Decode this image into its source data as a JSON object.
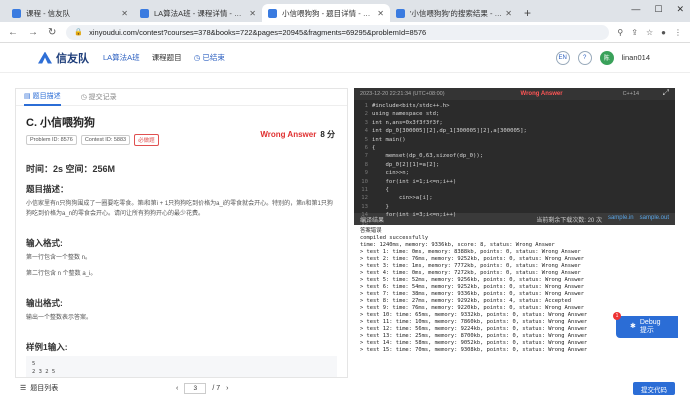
{
  "tabs": [
    {
      "title": "课程 - 信友队",
      "color": "#3a7be0",
      "active": false
    },
    {
      "title": "LA算法A班 - 课程详情 - 信友队",
      "color": "#3a7be0",
      "active": false
    },
    {
      "title": "小信喂狗狗 - 题目详情 - 信友队",
      "color": "#3a7be0",
      "active": true
    },
    {
      "title": "'小信喂狗狗'的搜索结果 - 信友队",
      "color": "#3a7be0",
      "active": false
    }
  ],
  "url": "xinyoudui.com/contest?courses=378&books=722&pages=20945&fragments=69295&problemId=8576",
  "header": {
    "brand": "信友队",
    "course": "LA算法A班",
    "nav1": "课程题目",
    "nav2": "已结束",
    "lang": "EN",
    "user": "linan014",
    "avatar": "陈"
  },
  "left": {
    "tab1": "题目描述",
    "tab2": "提交记录",
    "title": "C. 小信喂狗狗",
    "pid": "Problem ID: 8576",
    "cid": "Contest ID: 5883",
    "tag": "必做题",
    "verdict": "Wrong Answer",
    "score": "8 分",
    "limits": "时间：2s 空间：256M",
    "desc_h": "题目描述：",
    "desc": "小信家里有n只狗狗围成了一圈要吃零食。第i和第i + 1只狗狗吃到价格为a_i的零食就会开心。特别的，第n和第1只狗狗吃到价格为a_n的零食会开心。请问让所有狗狗开心的最少花费。",
    "input_h": "输入格式:",
    "input1": "第一行包含一个整数 n。",
    "input2": "第二行包含 n 个整数 a_i。",
    "output_h": "输出格式:",
    "output1": "输出一个整数表示答案。",
    "sample_h": "样例1输入:",
    "sample": "5\n2 3 2 5"
  },
  "bottom": {
    "qlist": "题目列表",
    "page": "3",
    "total": "/ 7",
    "submit": "提交代码"
  },
  "editor": {
    "time": "2023-12-20 22:21:34 (UTC+08:00)",
    "verdict": "Wrong Answer",
    "lang": "C++14",
    "lines": [
      "1",
      "2",
      "3",
      "4",
      "5",
      "6",
      "7",
      "8",
      "9",
      "10",
      "11",
      "12",
      "13",
      "14",
      "15"
    ],
    "code": "#include<bits/stdc++.h>\nusing namespace std;\nint n,ans=0x3f3f3f3f;\nint dp_0[300005][2],dp_1[300005][2],a[300005];\nint main()\n{\n    memset(dp_0,63,sizeof(dp_0));\n    dp_0[2][1]=a[2];\n    cin>>n;\n    for(int i=1;i<=n;i++)\n    {\n        cin>>a[i];\n    }\n    for(int i=3;i<=n;i++)"
  },
  "judge": {
    "title": "编译结果",
    "remaining": "当前剩余下载次数: 20 次",
    "in": "sample.in",
    "out": "sample.out",
    "text": "答案错误\ncompiled successfully\ntime: 1240ms, memory: 9336kb, score: 8, status: Wrong Answer\n> test 1: time: 0ms, memory: 8388kb, points: 0, status: Wrong Answer\n> test 2: time: 76ms, memory: 9252kb, points: 0, status: Wrong Answer\n> test 3: time: 1ms, memory: 7772kb, points: 0, status: Wrong Answer\n> test 4: time: 0ms, memory: 7272kb, points: 0, status: Wrong Answer\n> test 5: time: 52ms, memory: 9256kb, points: 0, status: Wrong Answer\n> test 6: time: 54ms, memory: 9252kb, points: 0, status: Wrong Answer\n> test 7: time: 38ms, memory: 9336kb, points: 0, status: Wrong Answer\n> test 8: time: 27ms, memory: 9292kb, points: 4, status: Accepted\n> test 9: time: 76ms, memory: 9220kb, points: 0, status: Wrong Answer\n> test 10: time: 65ms, memory: 9332kb, points: 0, status: Wrong Answer\n> test 11: time: 10ms, memory: 7860kb, points: 0, status: Wrong Answer\n> test 12: time: 56ms, memory: 9224kb, points: 0, status: Wrong Answer\n> test 13: time: 25ms, memory: 8700kb, points: 0, status: Wrong Answer\n> test 14: time: 58ms, memory: 9052kb, points: 0, status: Wrong Answer\n> test 15: time: 70ms, memory: 9308kb, points: 0, status: Wrong Answer"
  },
  "debug": {
    "label1": "Debug",
    "label2": "提示",
    "count": "1"
  }
}
